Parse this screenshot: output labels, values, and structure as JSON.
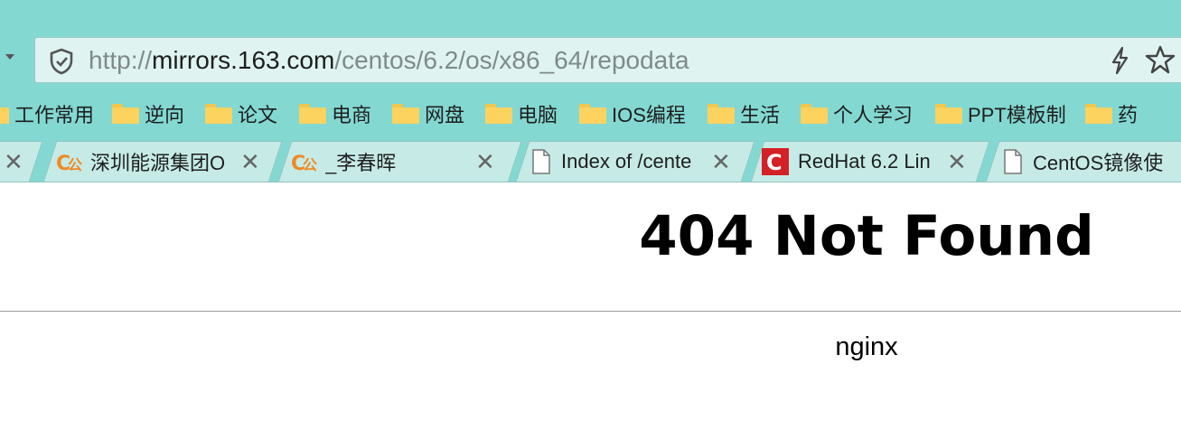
{
  "address_bar": {
    "url_scheme": "http://",
    "url_host": "mirrors.163.com",
    "url_path": "/centos/6.2/os/x86_64/repodata"
  },
  "bookmarks": [
    {
      "label": "工作常用"
    },
    {
      "label": "逆向"
    },
    {
      "label": "论文"
    },
    {
      "label": "电商"
    },
    {
      "label": "网盘"
    },
    {
      "label": "电脑"
    },
    {
      "label": "IOS编程"
    },
    {
      "label": "生活"
    },
    {
      "label": "个人学习"
    },
    {
      "label": "PPT模板制"
    },
    {
      "label": "药"
    }
  ],
  "tabs": [
    {
      "title": "深圳能源集团O",
      "icon": "cnki-icon"
    },
    {
      "title": "_李春晖",
      "icon": "cnki-icon"
    },
    {
      "title": "Index of /cente",
      "icon": "page-icon"
    },
    {
      "title": "RedHat 6.2 Lin",
      "icon": "c-logo-icon"
    },
    {
      "title": "CentOS镜像使",
      "icon": "page-icon"
    }
  ],
  "page": {
    "heading": "404 Not Found",
    "server": "nginx"
  },
  "colors": {
    "toolbar_bg": "#83d8d2",
    "tab_bg": "#c6ebe7",
    "folder": "#fcd35e",
    "cnki_orange": "#f08a24",
    "c_logo_red": "#d42027"
  }
}
